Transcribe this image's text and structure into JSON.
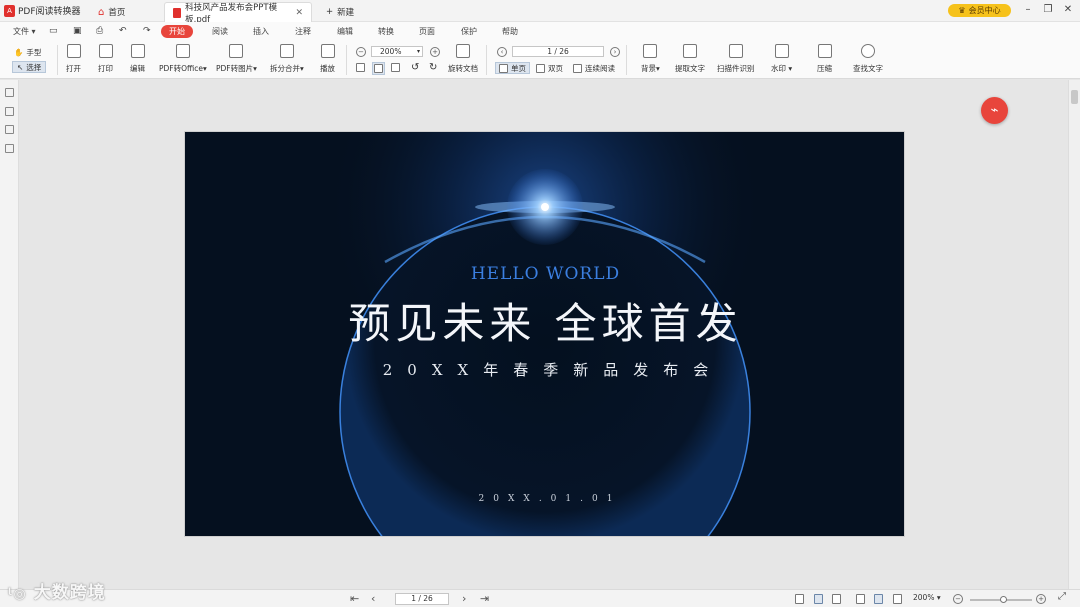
{
  "app": {
    "name": "PDF阅读转换器"
  },
  "tabs": {
    "home": "首页",
    "doc": "科技风产品发布会PPT模板.pdf",
    "new": "新建"
  },
  "vip": "会员中心",
  "menu": {
    "file": "文件",
    "items": [
      "开始",
      "阅读",
      "插入",
      "注释",
      "编辑",
      "转换",
      "页面",
      "保护",
      "帮助"
    ]
  },
  "toolbar": {
    "hand": "手型",
    "select": "选择",
    "open": "打开",
    "print": "打印",
    "edit": "编辑",
    "to_office": "PDF转Office",
    "to_image": "PDF转图片",
    "split_merge": "拆分合并",
    "play": "播放",
    "zoom": "200%",
    "page": "1 / 26",
    "rotate": "旋转文档",
    "single": "单页",
    "double": "双页",
    "continuous": "连续阅读",
    "background": "背景",
    "extract_text": "提取文字",
    "ocr": "扫描件识别",
    "watermark": "水印",
    "compress": "压缩",
    "find_text": "查找文字"
  },
  "slide": {
    "hello": "HELLO WORLD",
    "title": "预见未来  全球首发",
    "subtitle": "20XX年春季新品发布会",
    "date": "20XX.01.01"
  },
  "status": {
    "page": "1 / 26",
    "zoom": "200%"
  },
  "watermark_text": "大数跨境",
  "colors": {
    "accent": "#e8453c",
    "slide_bg": "#05101f",
    "hello": "#3b7fe0",
    "vip": "#f6c21b"
  }
}
